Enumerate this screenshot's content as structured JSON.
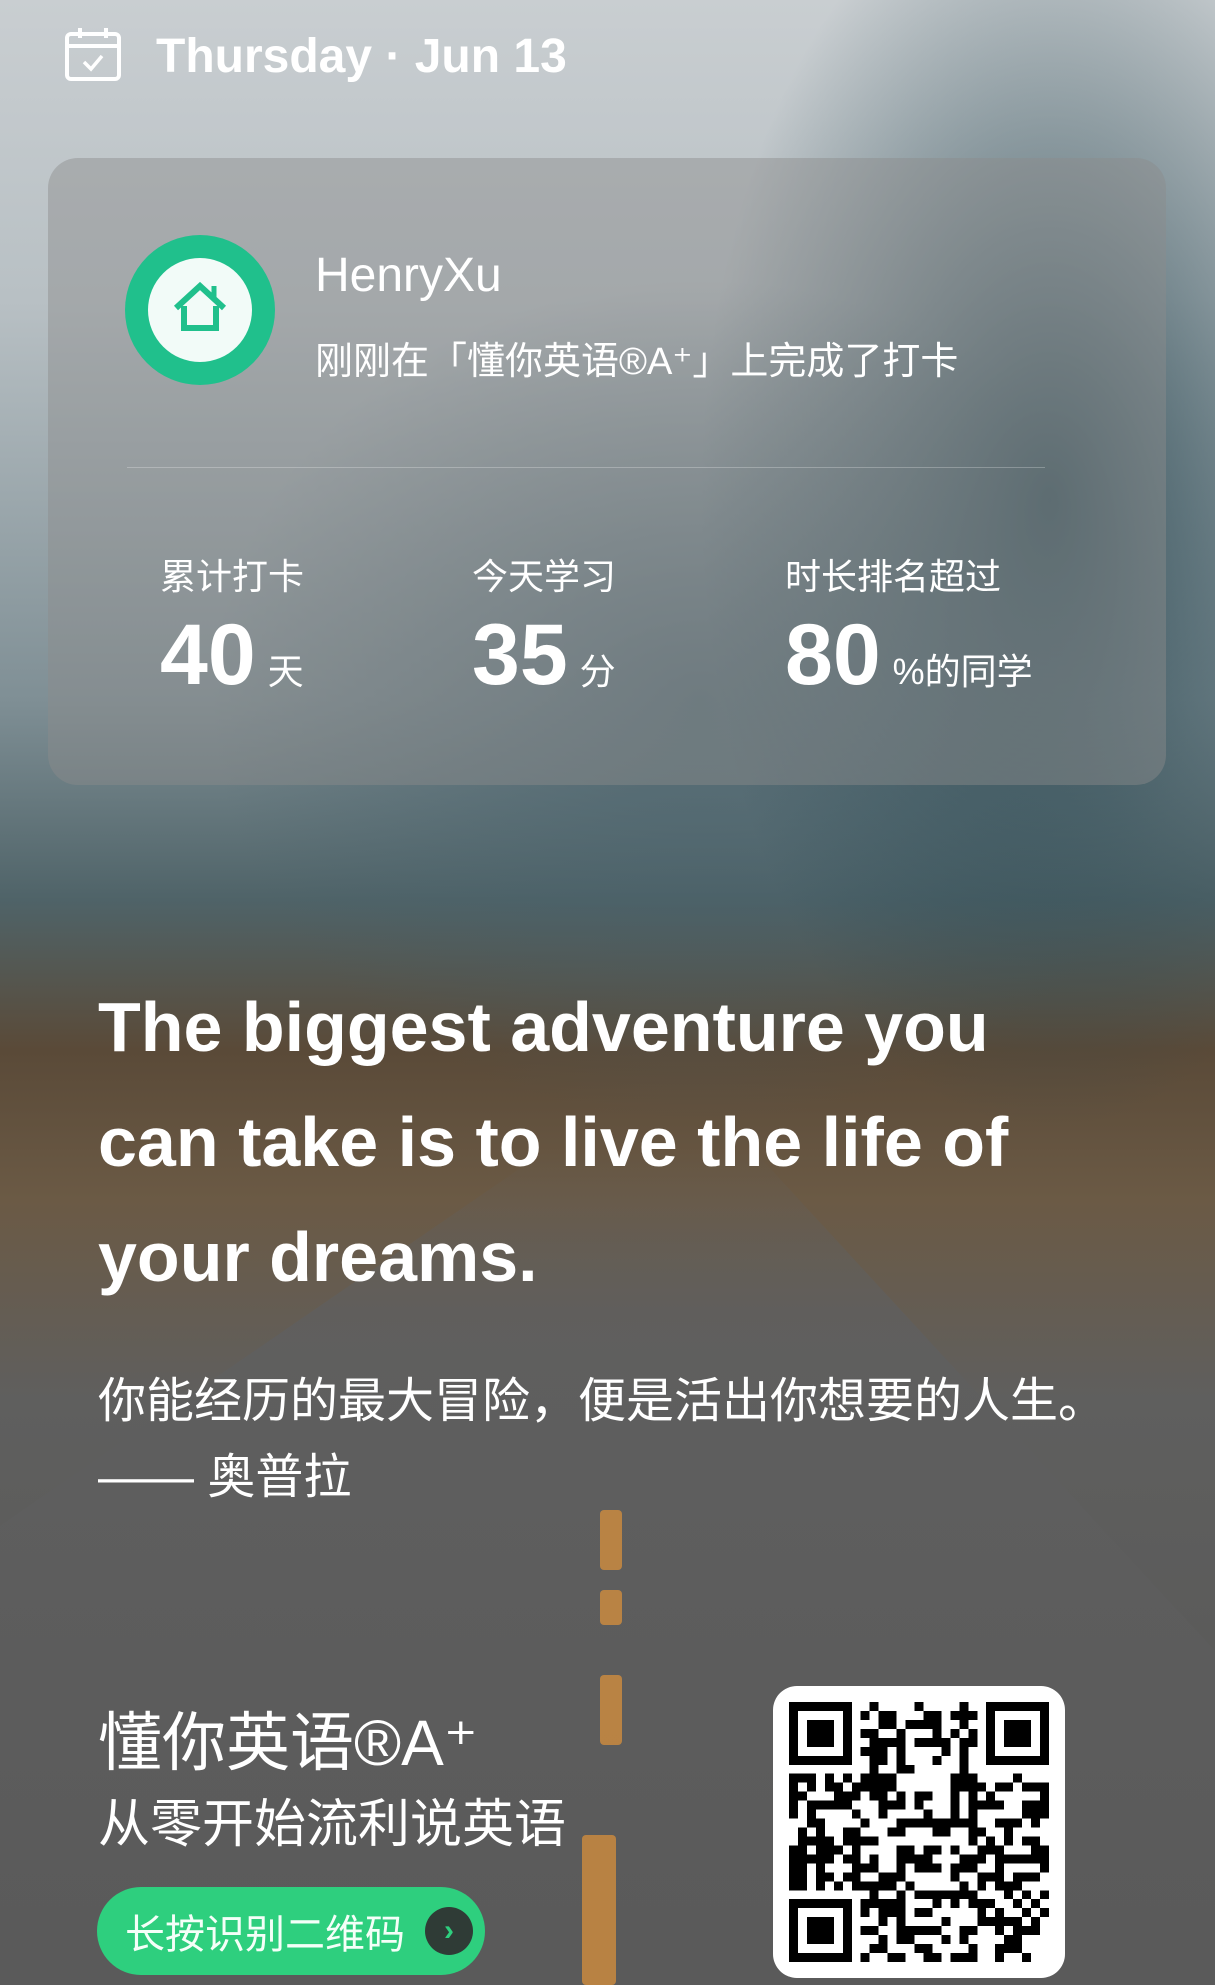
{
  "header": {
    "date": "Thursday · Jun 13",
    "icon": "calendar-check-icon"
  },
  "card": {
    "username": "HenryXu",
    "message": "刚刚在「懂你英语®A⁺」上完成了打卡",
    "avatar_icon": "home-icon",
    "stats": [
      {
        "label": "累计打卡",
        "value": "40",
        "unit": "天"
      },
      {
        "label": "今天学习",
        "value": "35",
        "unit": "分"
      },
      {
        "label": "时长排名超过",
        "value": "80",
        "unit": "%的同学"
      }
    ]
  },
  "quote": {
    "en": "The biggest adventure you can take is to live the life of your dreams.",
    "cn": "你能经历的最大冒险，便是活出你想要的人生。—— 奥普拉"
  },
  "footer": {
    "brand": "懂你英语®A⁺",
    "slogan": "从零开始流利说英语",
    "button_label": "长按识别二维码",
    "qr_icon": "qr-code"
  },
  "colors": {
    "accent": "#2ecf7e",
    "avatar": "#20c08c"
  }
}
